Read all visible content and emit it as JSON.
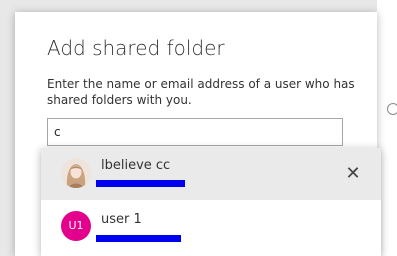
{
  "dialog": {
    "title": "Add shared folder",
    "description": "Enter the name or email address of a user who has shared folders with you.",
    "search": {
      "value": "c",
      "placeholder": ""
    }
  },
  "suggestions": [
    {
      "name": "lbelieve cc",
      "avatar": "photo-avatar",
      "selected": true,
      "remove_icon": "close-icon",
      "remove_glyph": "✕"
    },
    {
      "name": "user 1",
      "avatar_initials": "U1",
      "avatar_color": "#e3008c",
      "selected": false
    }
  ],
  "colors": {
    "redaction": "#0000f0",
    "selected_row": "#eaeaea"
  }
}
